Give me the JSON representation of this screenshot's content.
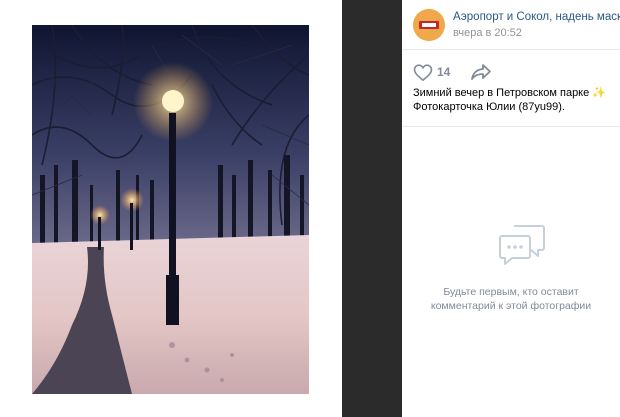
{
  "post": {
    "group_name": "Аэропорт и Сокол, надень маску",
    "time": "вчера в 20:52",
    "likes": "14",
    "caption_line1": "Зимний вечер в Петровском парке",
    "sparkle": "✨",
    "caption_line2": "Фотокарточка Юлии (87yu99)."
  },
  "comments": {
    "empty_line1": "Будьте первым, кто оставит",
    "empty_line2": "комментарий к этой фотографии"
  },
  "icons": {
    "like": "heart-icon",
    "share": "share-arrow-icon",
    "empty": "comments-icon"
  },
  "colors": {
    "link": "#2a5885",
    "muted": "#828a99",
    "dark_bar": "#2b2b2b"
  }
}
